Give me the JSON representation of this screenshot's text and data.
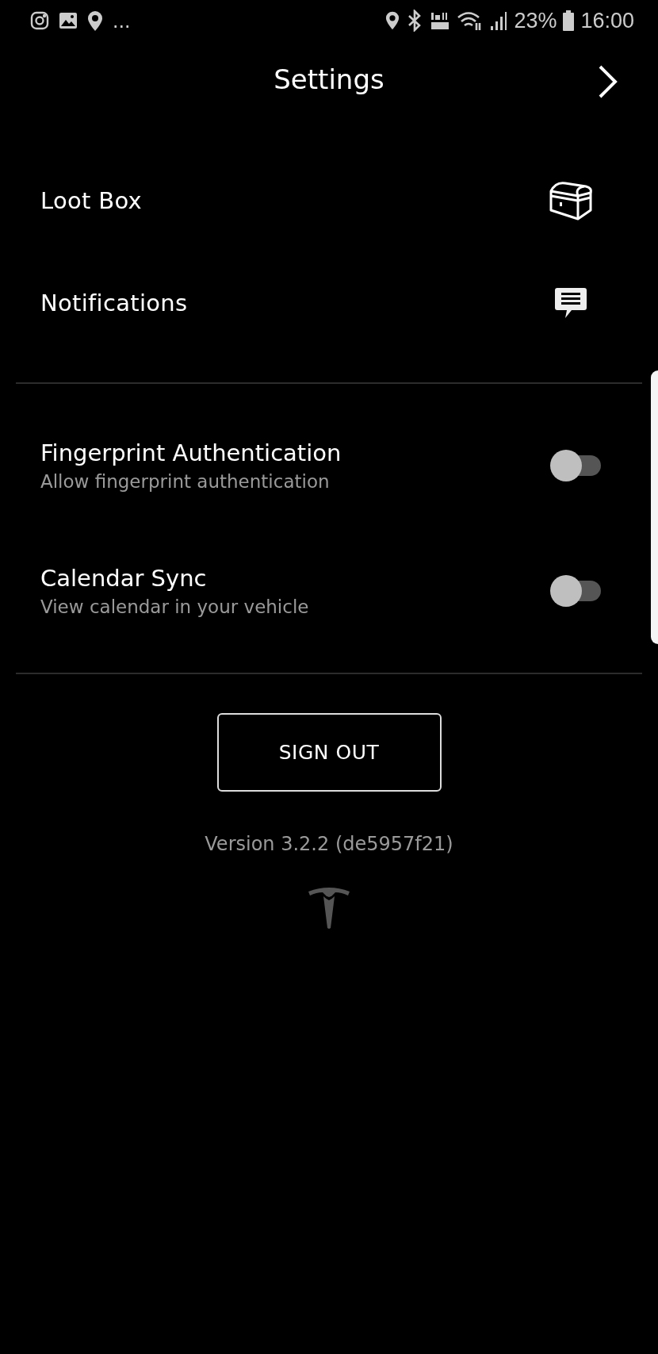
{
  "status_bar": {
    "more": "...",
    "battery": "23%",
    "time": "16:00"
  },
  "header": {
    "title": "Settings"
  },
  "sections": [
    {
      "items": [
        {
          "kind": "link",
          "label": "Loot Box"
        },
        {
          "kind": "link",
          "label": "Notifications"
        }
      ]
    },
    {
      "items": [
        {
          "kind": "toggle",
          "label": "Fingerprint Authentication",
          "description": "Allow fingerprint authentication",
          "on": false
        },
        {
          "kind": "toggle",
          "label": "Calendar Sync",
          "description": "View calendar in your vehicle",
          "on": false
        }
      ]
    }
  ],
  "sign_out": {
    "label": "SIGN OUT"
  },
  "version": "Version 3.2.2 (de5957f21)"
}
